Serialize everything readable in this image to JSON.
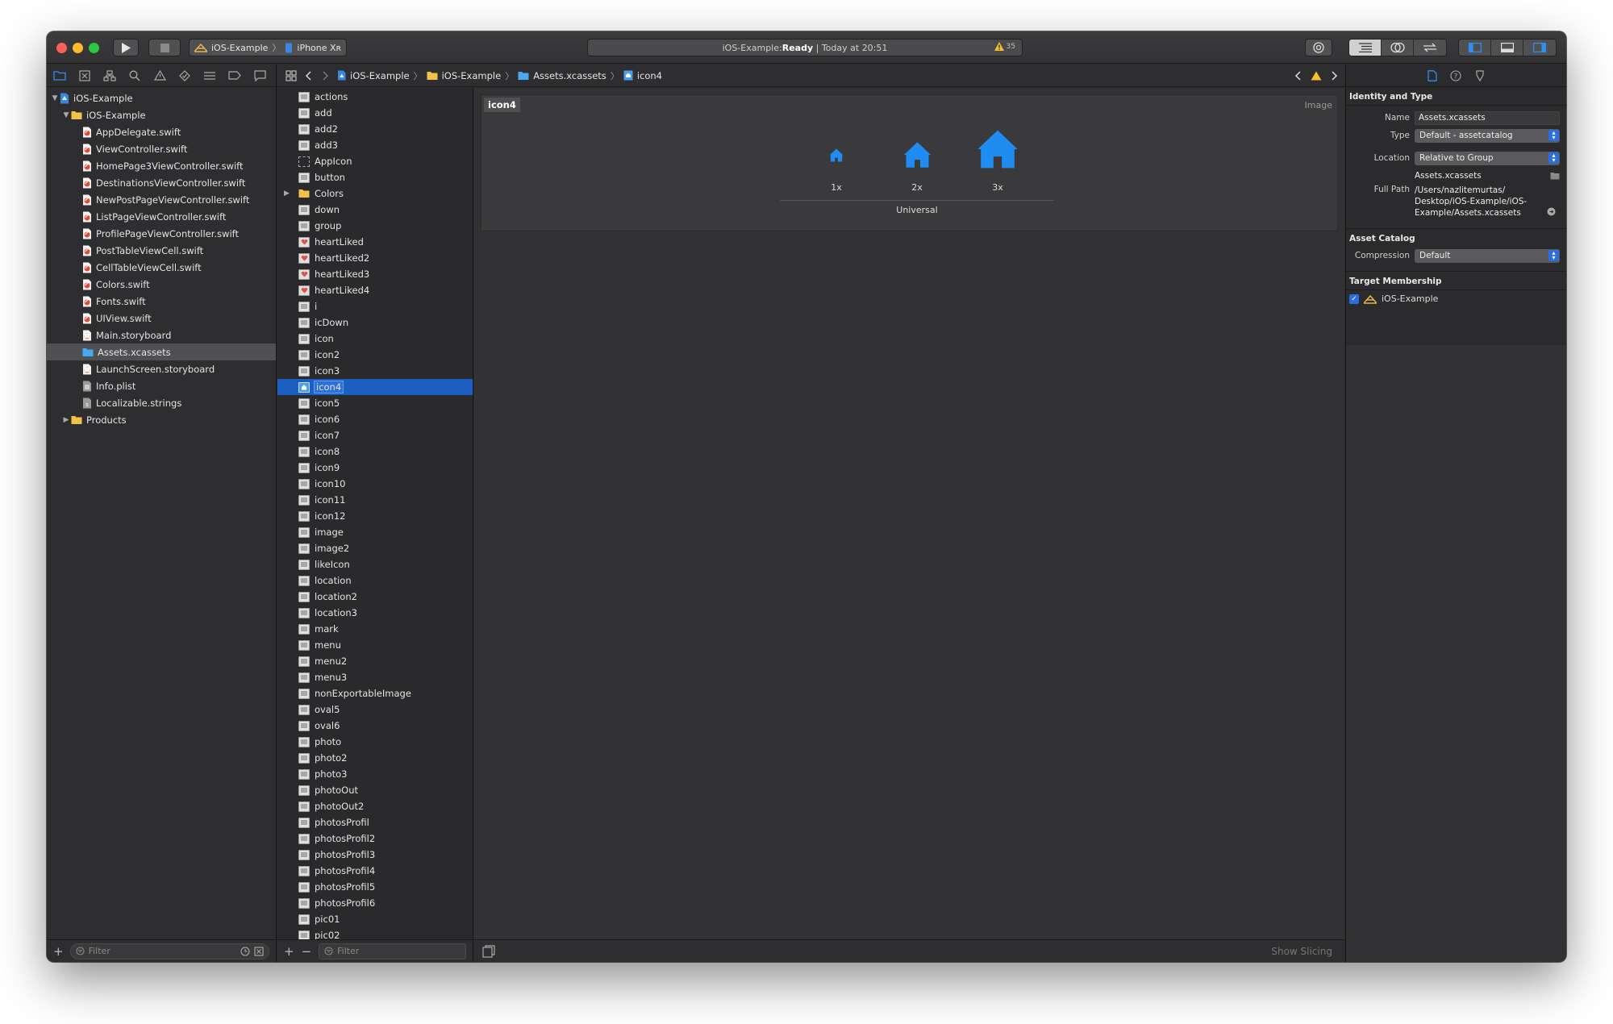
{
  "window": {
    "scheme": "iOS-Example",
    "device": "iPhone Xʀ",
    "status_project": "iOS-Example: ",
    "status_state": "Ready",
    "status_sep": " | ",
    "status_time": "Today at 20:51",
    "warning_count": "35"
  },
  "navigator": {
    "project": "iOS-Example",
    "group": "iOS-Example",
    "files": [
      "AppDelegate.swift",
      "ViewController.swift",
      "HomePage3ViewController.swift",
      "DestinationsViewController.swift",
      "NewPostPageViewController.swift",
      "ListPageViewController.swift",
      "ProfilePageViewController.swift",
      "PostTableViewCell.swift",
      "CellTableViewCell.swift",
      "Colors.swift",
      "Fonts.swift",
      "UIView.swift",
      "Main.storyboard",
      "Assets.xcassets",
      "LaunchScreen.storyboard",
      "Info.plist",
      "Localizable.strings"
    ],
    "products": "Products",
    "filter_placeholder": "Filter"
  },
  "jumpbar": {
    "crumbs": [
      "iOS-Example",
      "iOS-Example",
      "Assets.xcassets",
      "icon4"
    ]
  },
  "assets": {
    "items": [
      "actions",
      "add",
      "add2",
      "add3",
      "AppIcon",
      "button",
      "Colors",
      "down",
      "group",
      "heartLiked",
      "heartLiked2",
      "heartLiked3",
      "heartLiked4",
      "i",
      "icDown",
      "icon",
      "icon2",
      "icon3",
      "icon4",
      "icon5",
      "icon6",
      "icon7",
      "icon8",
      "icon9",
      "icon10",
      "icon11",
      "icon12",
      "image",
      "image2",
      "likeIcon",
      "location",
      "location2",
      "location3",
      "mark",
      "menu",
      "menu2",
      "menu3",
      "nonExportableImage",
      "oval5",
      "oval6",
      "photo",
      "photo2",
      "photo3",
      "photoOut",
      "photoOut2",
      "photosProfil",
      "photosProfil2",
      "photosProfil3",
      "photosProfil4",
      "photosProfil5",
      "photosProfil6",
      "pic01",
      "pic02"
    ],
    "selected": "icon4",
    "filter_placeholder": "Filter"
  },
  "editor": {
    "asset_name": "icon4",
    "asset_type": "Image",
    "slots": [
      "1x",
      "2x",
      "3x"
    ],
    "idiom": "Universal",
    "show_slicing": "Show Slicing",
    "accent_color": "#1e8cf0"
  },
  "inspector": {
    "identity_header": "Identity and Type",
    "name_label": "Name",
    "name_value": "Assets.xcassets",
    "type_label": "Type",
    "type_value": "Default - assetcatalog",
    "location_label": "Location",
    "location_value": "Relative to Group",
    "location_file": "Assets.xcassets",
    "fullpath_label": "Full Path",
    "fullpath_value": "/Users/nazlitemurtas/ Desktop/iOS-Example/iOS-Example/Assets.xcassets",
    "catalog_header": "Asset Catalog",
    "compression_label": "Compression",
    "compression_value": "Default",
    "membership_header": "Target Membership",
    "membership_target": "iOS-Example"
  }
}
